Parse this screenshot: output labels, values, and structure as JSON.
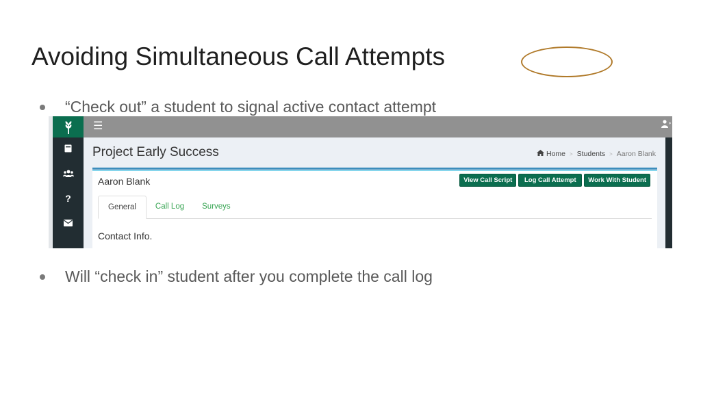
{
  "slide": {
    "title": "Avoiding Simultaneous Call Attempts",
    "bullets": [
      "“Check out” a student to signal active contact attempt",
      "Will “check in” student after you complete the call log"
    ]
  },
  "app": {
    "topbar": {
      "menu_icon": "☰",
      "user_icon": "👤"
    },
    "sidebar": {
      "logo_icon": "wheat-logo-icon",
      "items": [
        {
          "icon": "book-icon",
          "glyph": "▰"
        },
        {
          "icon": "users-icon",
          "glyph": "👥"
        },
        {
          "icon": "help-icon",
          "glyph": "?"
        },
        {
          "icon": "mail-icon",
          "glyph": "✉"
        }
      ]
    },
    "page_heading": "Project Early Success",
    "breadcrumb": [
      "Home",
      "Students",
      "Aaron Blank"
    ],
    "student_name": "Aaron Blank",
    "buttons": {
      "view_call_script": "View Call Script",
      "log_call_attempt": "Log Call Attempt",
      "work_with_student": "Work With Student"
    },
    "tabs": [
      "General",
      "Call Log",
      "Surveys"
    ],
    "active_tab": "General",
    "section_label": "Contact Info.",
    "colors": {
      "brand_green": "#0b6e4f",
      "tab_link_green": "#3aa655",
      "highlight_ring": "#b07a2a",
      "sidebar_dark": "#222d32"
    }
  }
}
